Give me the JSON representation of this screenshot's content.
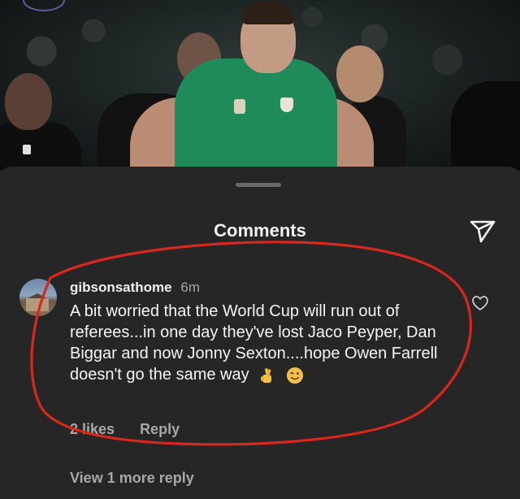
{
  "sheet": {
    "title": "Comments"
  },
  "comment": {
    "username": "gibsonsathome",
    "time": "6m",
    "text": "A bit worried that the World Cup will run out of referees...in one day they've lost Jaco Peyper, Dan Biggar and now Jonny Sexton....hope Owen Farrell doesn't go the same way",
    "likes": "2 likes",
    "reply_label": "Reply"
  },
  "replies": {
    "view_more_label": "View 1 more reply"
  },
  "icons": {
    "send": "send-icon",
    "like": "heart-icon",
    "emoji_1": "crossed-fingers-icon",
    "emoji_2": "winking-face-icon"
  },
  "colors": {
    "background": "#262626",
    "text": "#f4f4f4",
    "muted": "#a8a8a8",
    "highlight": "#d8281e"
  }
}
